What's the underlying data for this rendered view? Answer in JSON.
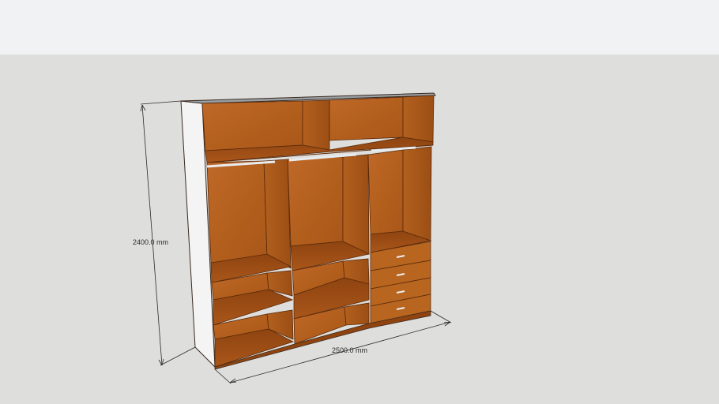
{
  "viewport": {
    "background": "#dededc",
    "top_band_color": "#f1f2f4"
  },
  "model": {
    "object": "wardrobe",
    "wood_color": "#b7651c",
    "edge_color": "#5a2a0a",
    "side_panel_color": "#f4f4f4",
    "rail_color": "#e8ecef",
    "sections": [
      {
        "name": "left",
        "interior": [
          "top-compartment",
          "hanging-rail",
          "shelves"
        ]
      },
      {
        "name": "middle",
        "interior": [
          "top-compartment",
          "hanging-rail",
          "shelves"
        ]
      },
      {
        "name": "right",
        "interior": [
          "top-compartment",
          "hanging-rail",
          "drawers"
        ]
      }
    ],
    "drawers": 4
  },
  "dimensions": {
    "height_label": "2400.0 mm",
    "width_label": "2500.0 mm"
  }
}
